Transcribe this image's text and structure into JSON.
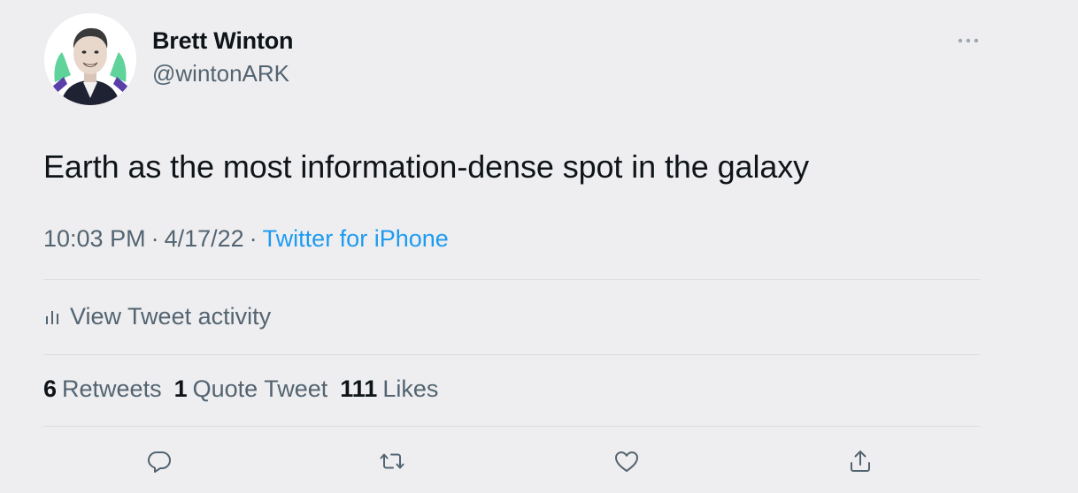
{
  "author": {
    "display_name": "Brett Winton",
    "handle": "@wintonARK"
  },
  "tweet": {
    "text": "Earth as the most information-dense spot in the galaxy",
    "time": "10:03 PM",
    "date": "4/17/22",
    "source": "Twitter for iPhone",
    "separator": "·"
  },
  "activity": {
    "label": "View Tweet activity"
  },
  "stats": {
    "retweets_count": "6",
    "retweets_label": "Retweets",
    "quotes_count": "1",
    "quotes_label": "Quote Tweet",
    "likes_count": "111",
    "likes_label": "Likes"
  },
  "icons": {
    "more": "more-icon",
    "activity": "bar-chart-icon",
    "reply": "reply-icon",
    "retweet": "retweet-icon",
    "like": "heart-icon",
    "share": "share-icon"
  },
  "colors": {
    "background": "#eeeef0",
    "text_primary": "#0f1419",
    "text_secondary": "#536471",
    "accent": "#1d9bf0",
    "divider": "#d9dde0"
  }
}
